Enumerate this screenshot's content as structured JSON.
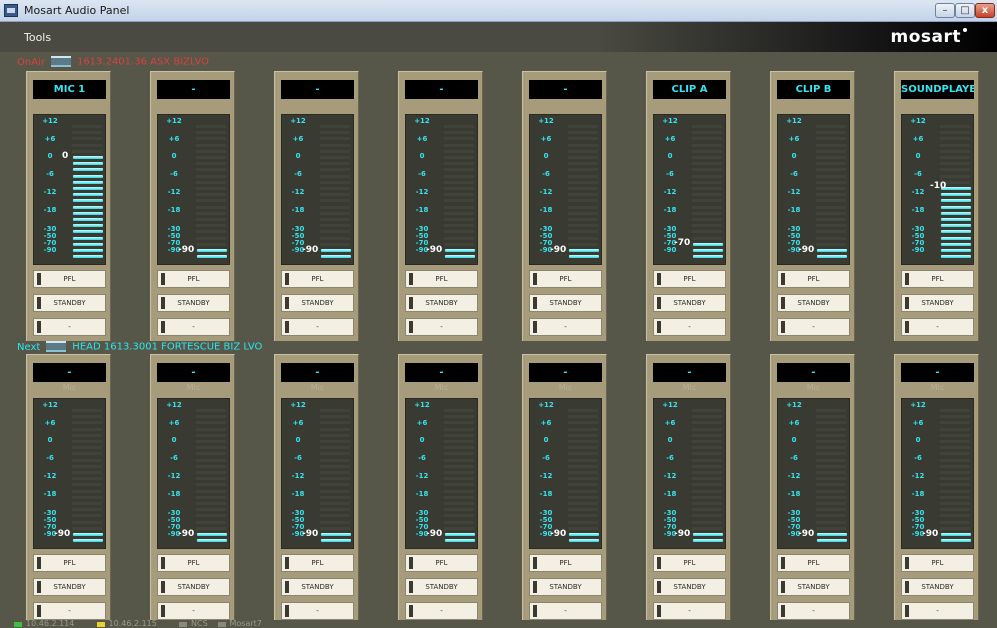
{
  "window": {
    "title": "Mosart Audio Panel",
    "controls": {
      "minimize": "–",
      "maximize": "□",
      "close": "x"
    }
  },
  "menu": {
    "tools": "Tools"
  },
  "brand": {
    "logo": "mosart"
  },
  "sections": {
    "onair": {
      "label": "OnAir",
      "text": "1613.2401.36 ASX BIZLVO",
      "color": "#d6423f"
    },
    "next": {
      "label": "Next",
      "text": "HEAD  1613.3001 FORTESCUE BIZ LVO",
      "color": "#2ae6ef"
    }
  },
  "scale_labels": [
    "+12",
    "+6",
    "0",
    "-6",
    "-12",
    "-18",
    "-30",
    "-50",
    "-70",
    "-90"
  ],
  "buttons": {
    "pfl": "PFL",
    "standby": "STANDBY",
    "third": "-"
  },
  "onair_channels": [
    {
      "name": "MIC 1",
      "sub": "",
      "level": 0,
      "readout": "0"
    },
    {
      "name": "-",
      "sub": "",
      "level": -90,
      "readout": "-90"
    },
    {
      "name": "-",
      "sub": "",
      "level": -90,
      "readout": "-90"
    },
    {
      "name": "-",
      "sub": "",
      "level": -90,
      "readout": "-90"
    },
    {
      "name": "-",
      "sub": "",
      "level": -90,
      "readout": "-90"
    },
    {
      "name": "CLIP A",
      "sub": "",
      "level": -70,
      "readout": "-70"
    },
    {
      "name": "CLIP B",
      "sub": "",
      "level": -90,
      "readout": "-90"
    },
    {
      "name": "SOUNDPLAYER",
      "sub": "",
      "level": -10,
      "readout": "-10"
    }
  ],
  "next_channels": [
    {
      "name": "-",
      "sub": "Mic",
      "level": -90,
      "readout": "-90"
    },
    {
      "name": "-",
      "sub": "Mic",
      "level": -90,
      "readout": "-90"
    },
    {
      "name": "-",
      "sub": "Mic",
      "level": -90,
      "readout": "-90"
    },
    {
      "name": "-",
      "sub": "Mic",
      "level": -90,
      "readout": "-90"
    },
    {
      "name": "-",
      "sub": "Mic",
      "level": -90,
      "readout": "-90"
    },
    {
      "name": "-",
      "sub": "Mic",
      "level": -90,
      "readout": "-90"
    },
    {
      "name": "-",
      "sub": "Mic",
      "level": -90,
      "readout": "-90"
    },
    {
      "name": "-",
      "sub": "Mic",
      "level": -90,
      "readout": "-90"
    }
  ],
  "status": {
    "items": [
      {
        "text": "10.46.2.114",
        "color": "#3fbf3f"
      },
      {
        "text": "10.46.2.115",
        "color": "#e8d22c"
      },
      {
        "text": "NCS",
        "color": "#8a8a7a"
      },
      {
        "text": "Mosart7",
        "color": "#8a8a7a"
      }
    ]
  },
  "colors": {
    "meter_lit": "#31d6e3",
    "panel": "#a69c7b",
    "background": "#565649"
  }
}
